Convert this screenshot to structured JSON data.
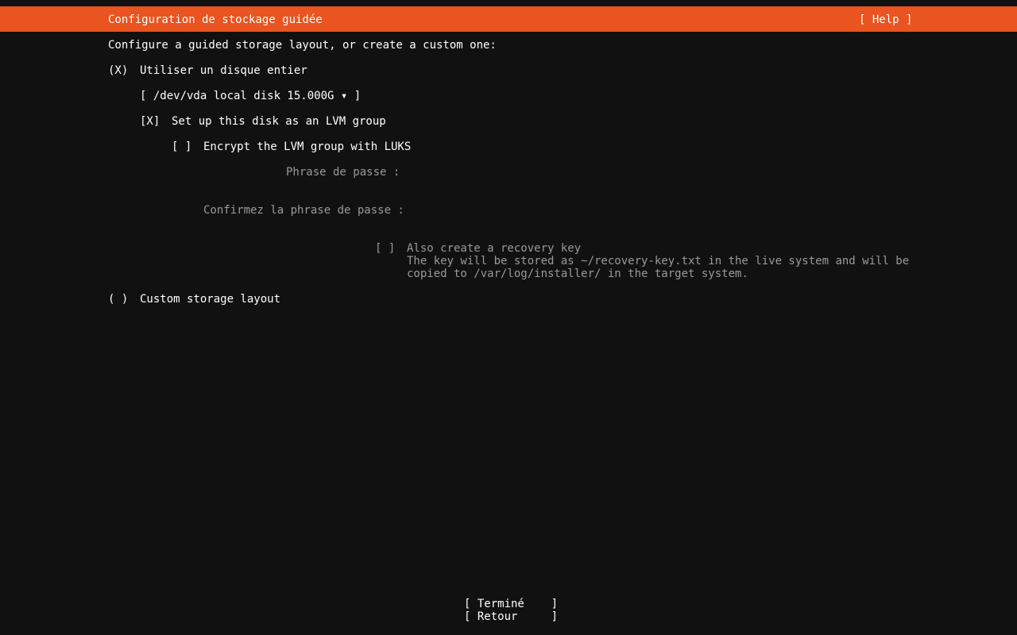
{
  "header": {
    "title": "Configuration de stockage guidée",
    "help_label": "[ Help ]"
  },
  "intro": "Configure a guided storage layout, or create a custom one:",
  "use_entire_disk": {
    "radio": "(X)",
    "label": "Utiliser un disque entier"
  },
  "disk_select": {
    "text": "[ /dev/vda local disk 15.000G ▾ ]"
  },
  "lvm": {
    "checkbox": "[X]",
    "label": "Set up this disk as an LVM group"
  },
  "luks": {
    "checkbox": "[ ]",
    "label": "Encrypt the LVM group with LUKS"
  },
  "passphrase": {
    "label": "Phrase de passe :",
    "value": ""
  },
  "confirm_passphrase": {
    "label": "Confirmez la phrase de passe :",
    "value": ""
  },
  "recovery_key": {
    "checkbox": "[ ]",
    "label": "Also create a recovery key",
    "help_line1": "The key will be stored as ~/recovery-key.txt in the live system and will be",
    "help_line2": "copied to /var/log/installer/ in the target system."
  },
  "custom_layout": {
    "radio": "( )",
    "label": "Custom storage layout"
  },
  "buttons": {
    "done": "[ Terminé    ]",
    "back": "[ Retour     ]"
  },
  "colors": {
    "accent": "#e95420",
    "background": "#111111",
    "text": "#ffffff",
    "disabled_text": "#9a9a9a"
  }
}
